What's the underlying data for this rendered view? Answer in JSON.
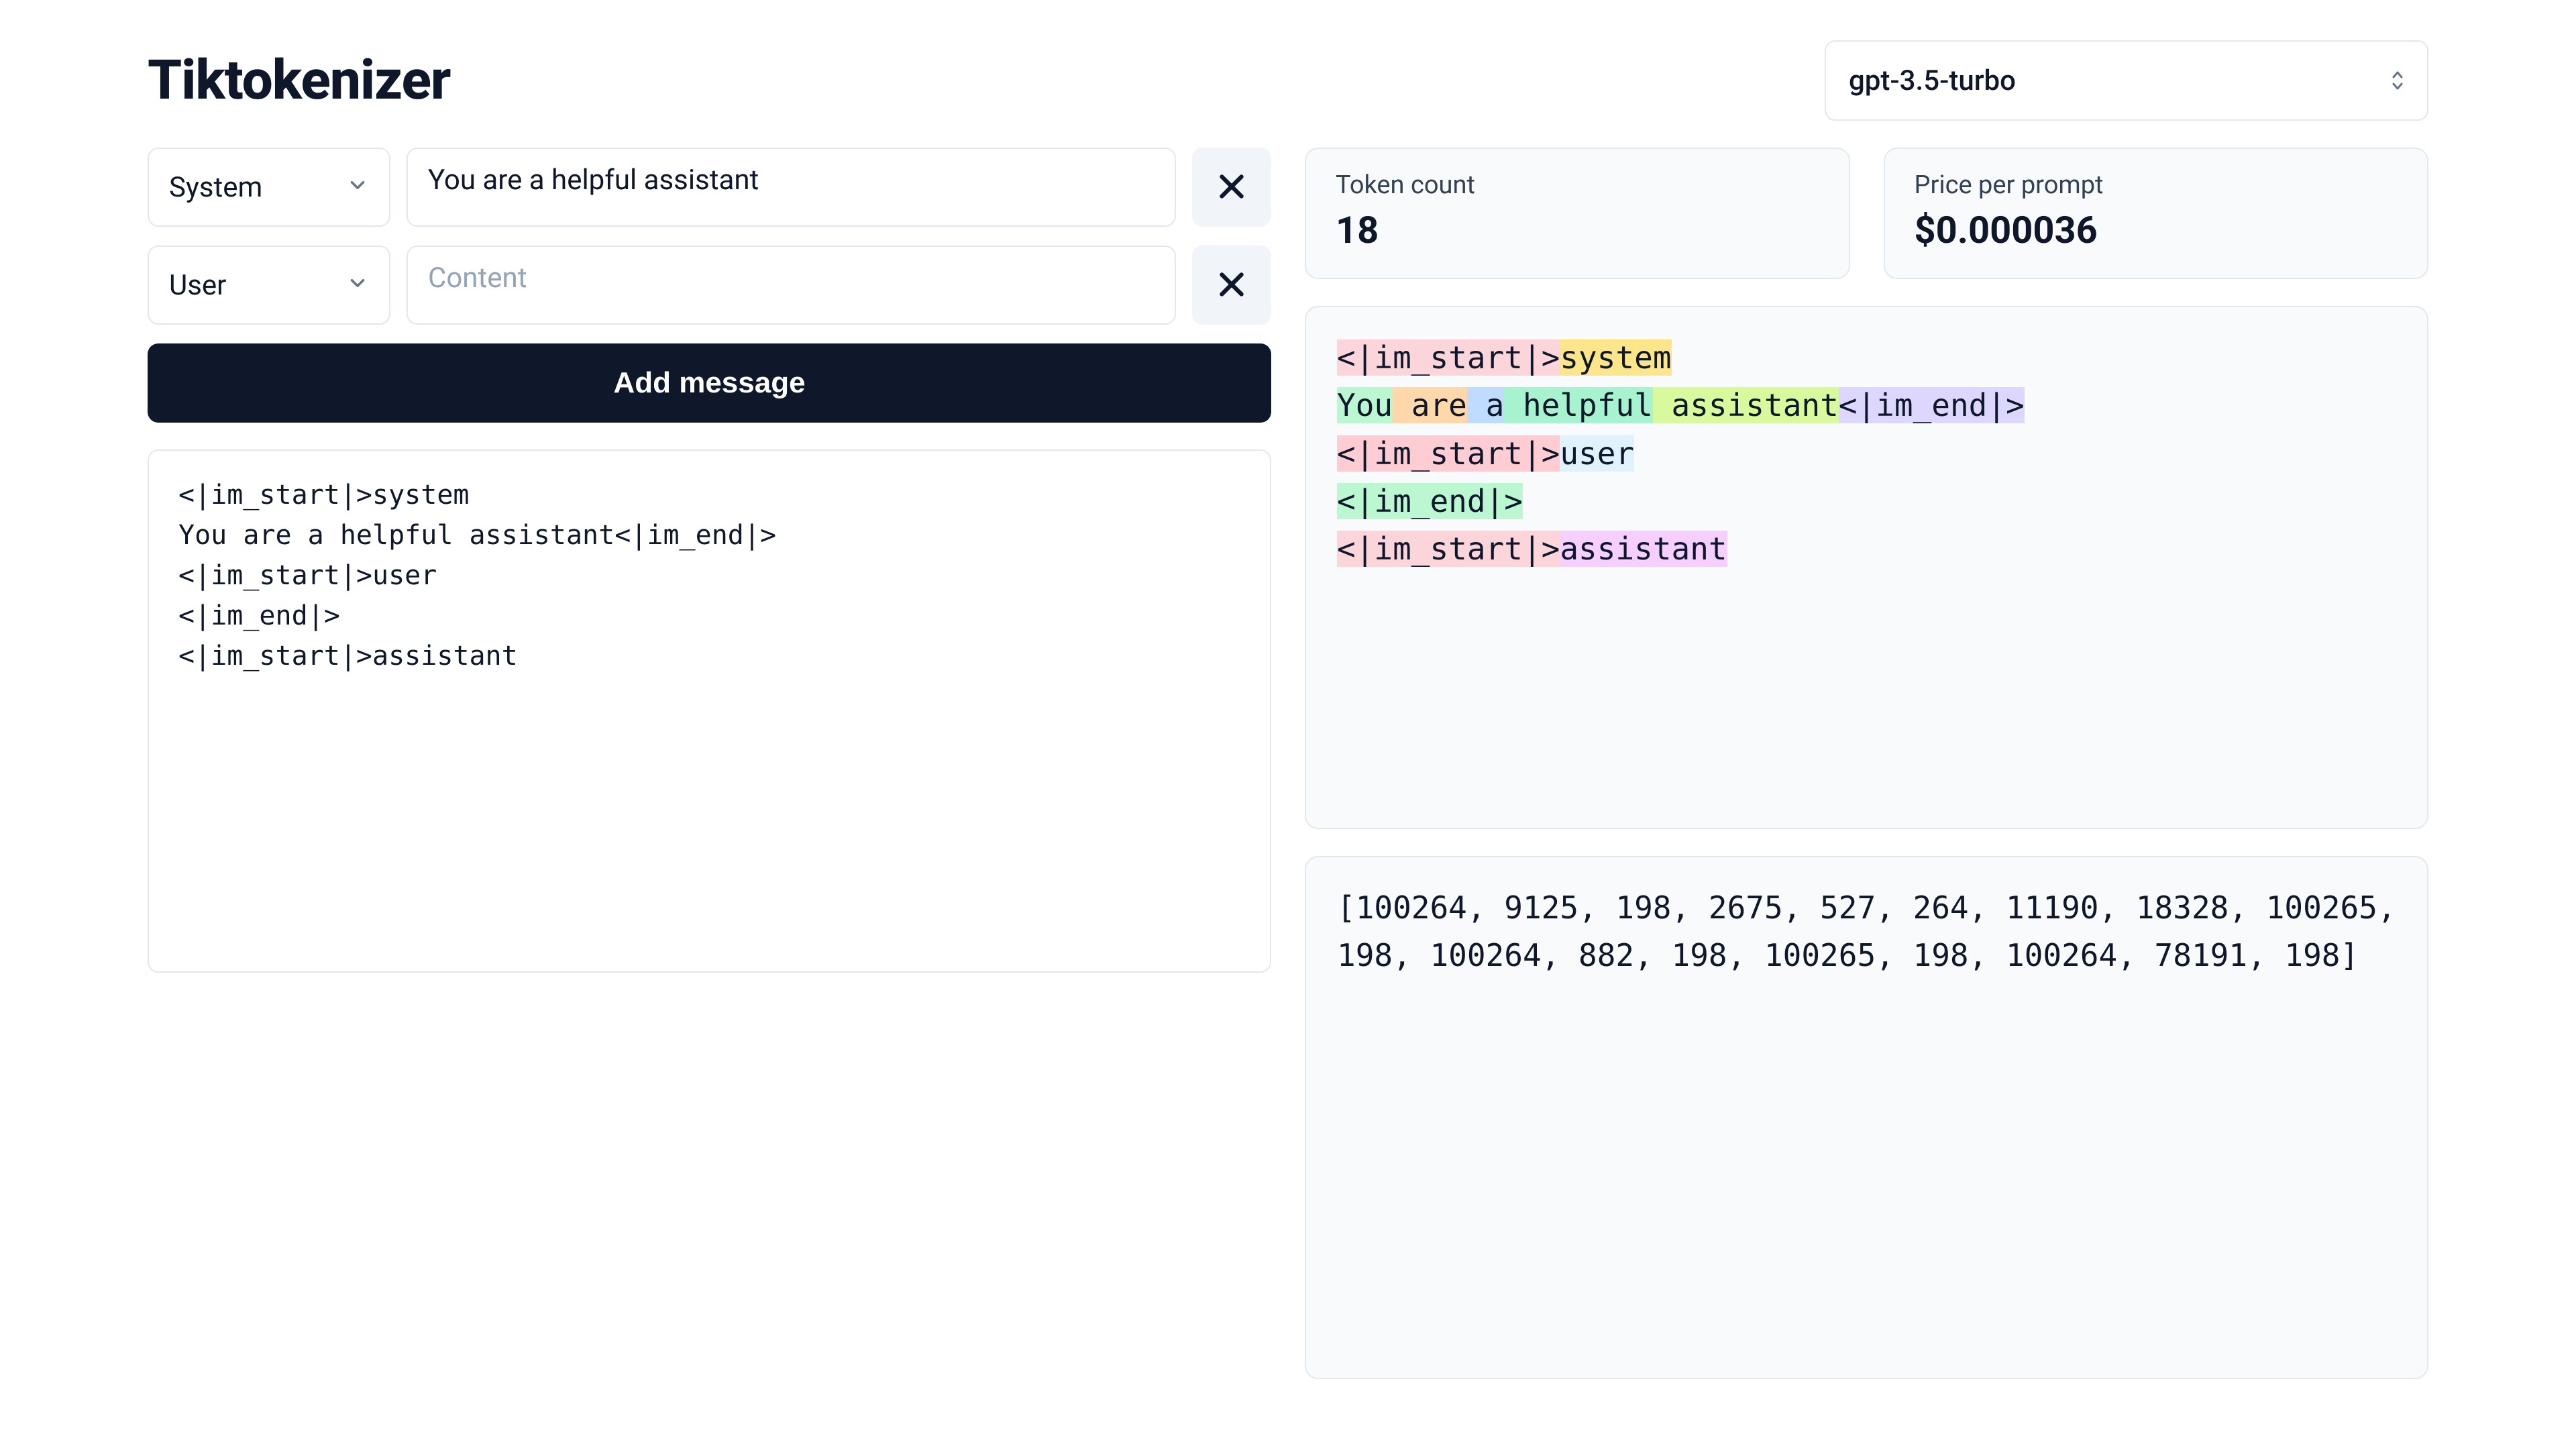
{
  "header": {
    "title": "Tiktokenizer",
    "model_selected": "gpt-3.5-turbo"
  },
  "messages": [
    {
      "role": "System",
      "content": "You are a helpful assistant",
      "placeholder": "Content"
    },
    {
      "role": "User",
      "content": "",
      "placeholder": "Content"
    }
  ],
  "add_message_label": "Add message",
  "raw_text": "<|im_start|>system\nYou are a helpful assistant<|im_end|>\n<|im_start|>user\n<|im_end|>\n<|im_start|>assistant",
  "stats": {
    "token_count_label": "Token count",
    "token_count_value": "18",
    "price_label": "Price per prompt",
    "price_value": "$0.000036"
  },
  "tokens": [
    {
      "text": "<|im_start|>",
      "color": "c-pink"
    },
    {
      "text": "system",
      "color": "c-yellow"
    },
    {
      "text": "\n",
      "color": ""
    },
    {
      "text": "You",
      "color": "c-green"
    },
    {
      "text": " are",
      "color": "c-orange"
    },
    {
      "text": " a",
      "color": "c-blue"
    },
    {
      "text": " helpful",
      "color": "c-mint"
    },
    {
      "text": " assistant",
      "color": "c-lime"
    },
    {
      "text": "<|im_end|>",
      "color": "c-lav"
    },
    {
      "text": "\n",
      "color": ""
    },
    {
      "text": "<|im_start|>",
      "color": "c-rose"
    },
    {
      "text": "user",
      "color": "c-sky"
    },
    {
      "text": "\n",
      "color": ""
    },
    {
      "text": "<|im_end|>",
      "color": "c-green"
    },
    {
      "text": "\n",
      "color": ""
    },
    {
      "text": "<|im_start|>",
      "color": "c-pink"
    },
    {
      "text": "assistant",
      "color": "c-violet"
    },
    {
      "text": "\n",
      "color": ""
    }
  ],
  "token_ids": "[100264, 9125, 198, 2675, 527, 264, 11190, 18328, 100265, 198, 100264, 882, 198, 100265, 198, 100264, 78191, 198]"
}
